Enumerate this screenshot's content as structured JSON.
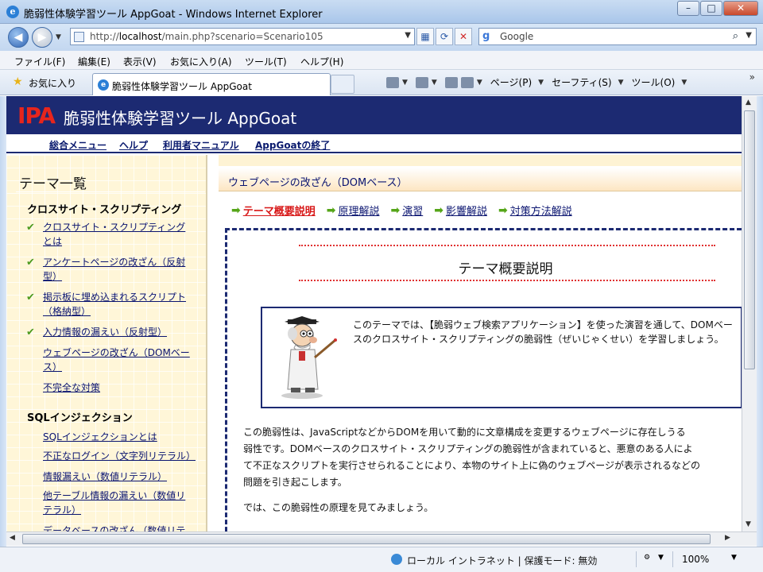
{
  "window": {
    "title": "脆弱性体験学習ツール AppGoat - Windows Internet Explorer",
    "btn_min": "–",
    "btn_max": "□",
    "btn_close": "✕"
  },
  "address": {
    "url_prefix": "http://",
    "url_host": "localhost",
    "url_rest": "/main.php?scenario=Scenario105"
  },
  "search": {
    "label": "Google"
  },
  "menu": {
    "items": [
      "ファイル(F)",
      "編集(E)",
      "表示(V)",
      "お気に入り(A)",
      "ツール(T)",
      "ヘルプ(H)"
    ]
  },
  "favbar": {
    "favorites_label": "お気に入り",
    "tab_title": "脆弱性体験学習ツール AppGoat",
    "page_label": "ページ(P)",
    "safety_label": "セーフティ(S)",
    "tools_label": "ツール(O)"
  },
  "banner": {
    "logo": "IPA",
    "title": "脆弱性体験学習ツール AppGoat"
  },
  "topnav": [
    "総合メニュー",
    "ヘルプ",
    "利用者マニュアル",
    "AppGoatの終了"
  ],
  "sidebar": {
    "heading": "テーマ一覧",
    "section1": "クロスサイト・スクリプティング",
    "items1": [
      {
        "label": "クロスサイト・スクリプティングとは",
        "done": true
      },
      {
        "label": "アンケートページの改ざん（反射型）",
        "done": true
      },
      {
        "label": "掲示板に埋め込まれるスクリプト（格納型）",
        "done": true
      },
      {
        "label": "入力情報の漏えい（反射型）",
        "done": true
      },
      {
        "label": "ウェブページの改ざん（DOMベース）",
        "done": false
      },
      {
        "label": "不完全な対策",
        "done": false
      }
    ],
    "section2": "SQLインジェクション",
    "items2": [
      "SQLインジェクションとは",
      "不正なログイン（文字列リテラル）",
      "情報漏えい（数値リテラル）",
      "他テーブル情報の漏えい（数値リテラル）",
      "データベースの改ざん（数値リテラル）"
    ]
  },
  "main": {
    "page_header": "ウェブページの改ざん（DOMベース）",
    "tabs": [
      {
        "label": "テーマ概要説明",
        "active": true
      },
      {
        "label": "原理解説",
        "active": false
      },
      {
        "label": "演習",
        "active": false
      },
      {
        "label": "影響解説",
        "active": false
      },
      {
        "label": "対策方法解説",
        "active": false
      }
    ],
    "section_title": "テーマ概要説明",
    "intro_text": "このテーマでは、【脆弱ウェブ検索アプリケーション】を使った演習を通して、DOMベースのクロスサイト・スクリプティングの脆弱性（ぜいじゃくせい）を学習しましょう。",
    "body_lines": [
      "この脆弱性は、JavaScriptなどからDOMを用いて動的に文章構成を変更するウェブページに存在しうる",
      "弱性です。DOMベースのクロスサイト・スクリプティングの脆弱性が含まれていると、悪意のある人によ",
      "て不正なスクリプトを実行させられることにより、本物のサイト上に偽のウェブページが表示されるなどの",
      "問題を引き起こします。"
    ],
    "body_closing": "では、この脆弱性の原理を見てみましょう。"
  },
  "statusbar": {
    "zone": "ローカル イントラネット | 保護モード: 無効",
    "zoom": "100%"
  },
  "colors": {
    "banner_bg": "#1c2a72",
    "logo_red": "#e8251c",
    "active_tab": "#d81818",
    "link": "#0a1470",
    "check_green": "#4c9a1f",
    "sidebar_bg": "#fff6d8"
  }
}
